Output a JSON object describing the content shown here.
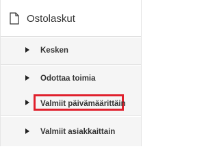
{
  "panel": {
    "title": "Ostolaskut",
    "icon": "document-icon",
    "items": [
      {
        "label": "Kesken",
        "highlighted": false
      },
      {
        "label": "Odottaa toimia",
        "highlighted": false
      },
      {
        "label": "Valmiit päivämäärittäin",
        "highlighted": true
      },
      {
        "label": "Valmiit asiakkaittain",
        "highlighted": false
      }
    ]
  },
  "colors": {
    "highlight_border": "#e0202c",
    "item_background": "#f5f5f5",
    "text": "#333333"
  }
}
